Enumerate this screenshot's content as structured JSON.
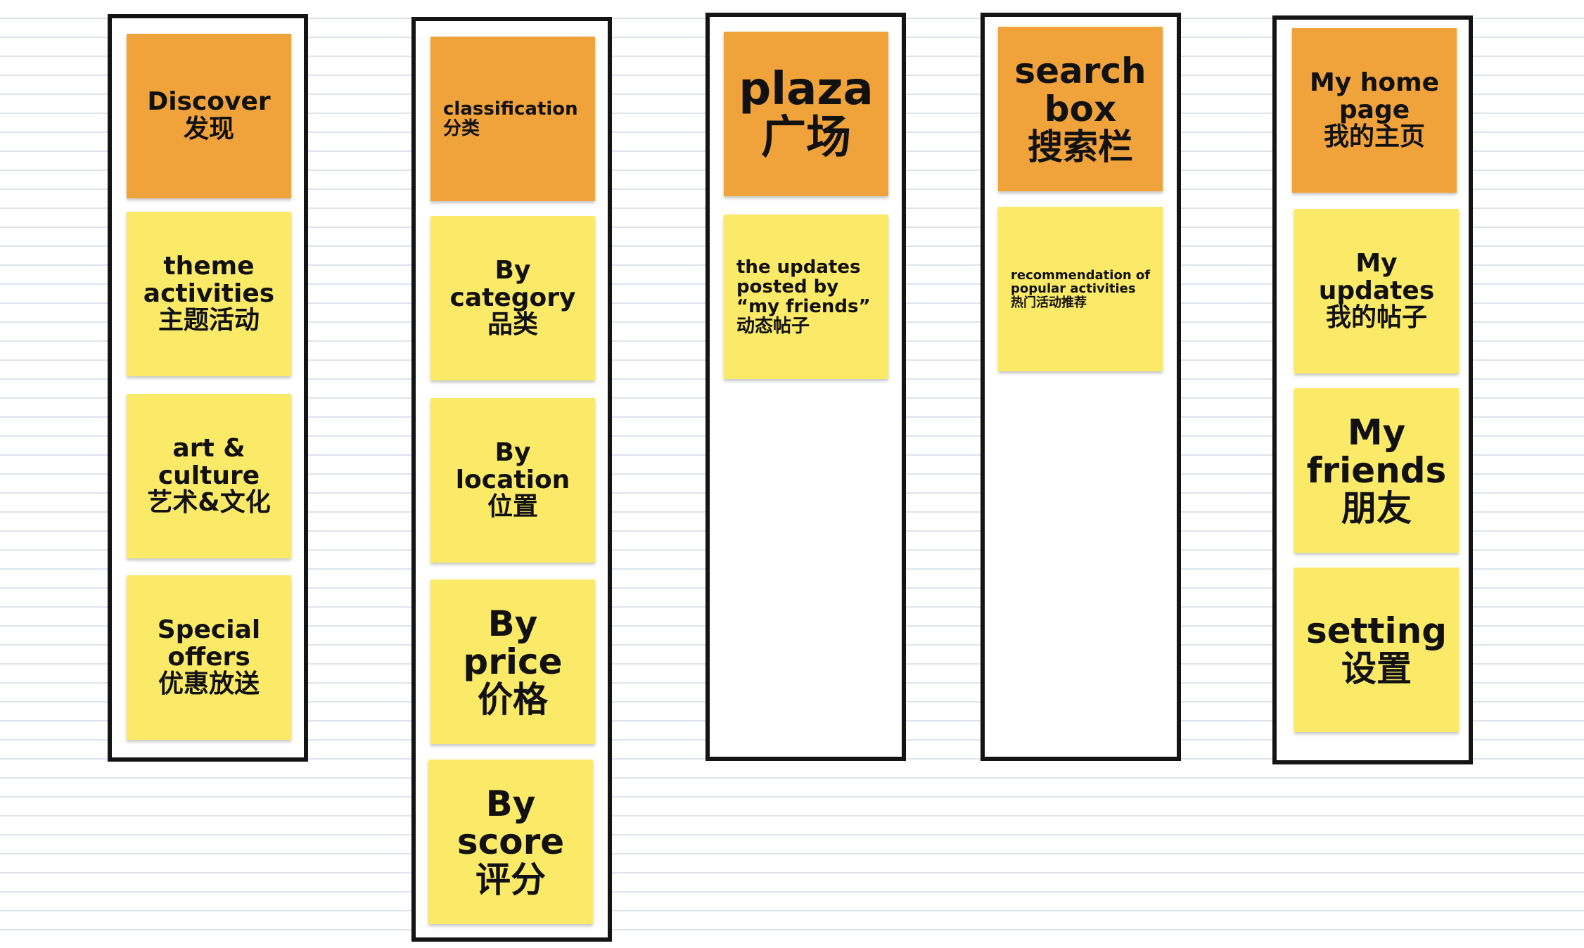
{
  "colors": {
    "header": "#f0a33b",
    "item": "#fbea67",
    "border": "#141414"
  },
  "columns": [
    {
      "header": {
        "en": "Discover",
        "zh": "发现"
      },
      "items": [
        {
          "en": "theme activities",
          "zh": "主题活动"
        },
        {
          "en": "art & culture",
          "zh": "艺术&文化"
        },
        {
          "en": "Special offers",
          "zh": "优惠放送"
        }
      ]
    },
    {
      "header": {
        "en": "classification",
        "zh": "分类"
      },
      "items": [
        {
          "en": "By category",
          "zh": "品类"
        },
        {
          "en": "By location",
          "zh": "位置"
        },
        {
          "en": "By price",
          "zh": "价格"
        },
        {
          "en": "By score",
          "zh": "评分"
        }
      ]
    },
    {
      "header": {
        "en": "plaza",
        "zh": "广场"
      },
      "items": [
        {
          "en": "the updates posted by “my friends”",
          "zh": "动态帖子"
        }
      ]
    },
    {
      "header": {
        "en": "search box",
        "zh": "搜索栏"
      },
      "items": [
        {
          "en": "recommendation of popular activities",
          "zh": "热门活动推荐"
        }
      ]
    },
    {
      "header": {
        "en": "My home page",
        "zh": "我的主页"
      },
      "items": [
        {
          "en": "My updates",
          "zh": "我的帖子"
        },
        {
          "en": "My friends",
          "zh": "朋友"
        },
        {
          "en": "setting",
          "zh": "设置"
        }
      ]
    }
  ]
}
